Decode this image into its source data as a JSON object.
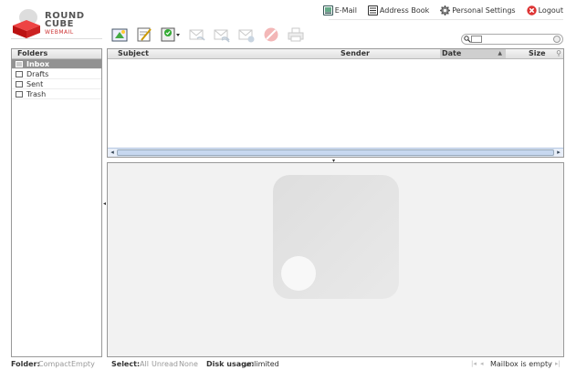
{
  "logo": {
    "line1": "ROUND",
    "line2": "CUBE",
    "line3": "WEBMAIL"
  },
  "topnav": {
    "items": [
      {
        "label": "E-Mail",
        "icon": "mail-icon"
      },
      {
        "label": "Address Book",
        "icon": "address-book-icon"
      },
      {
        "label": "Personal Settings",
        "icon": "gear-icon"
      },
      {
        "label": "Logout",
        "icon": "logout-icon"
      }
    ]
  },
  "toolbar": {
    "buttons": [
      {
        "name": "check-mail",
        "icon": "check-mail-icon",
        "enabled": true
      },
      {
        "name": "compose",
        "icon": "compose-icon",
        "enabled": true
      },
      {
        "name": "mark",
        "icon": "mark-icon",
        "enabled": true
      },
      {
        "name": "reply",
        "icon": "reply-icon",
        "enabled": false
      },
      {
        "name": "reply-all",
        "icon": "reply-all-icon",
        "enabled": false
      },
      {
        "name": "forward",
        "icon": "forward-icon",
        "enabled": false
      },
      {
        "name": "delete",
        "icon": "delete-icon",
        "enabled": false
      },
      {
        "name": "print",
        "icon": "print-icon",
        "enabled": false
      }
    ]
  },
  "folders": {
    "title": "Folders",
    "items": [
      {
        "label": "Inbox",
        "selected": true
      },
      {
        "label": "Drafts",
        "selected": false
      },
      {
        "label": "Sent",
        "selected": false
      },
      {
        "label": "Trash",
        "selected": false
      }
    ]
  },
  "messagelist": {
    "columns": {
      "subject": "Subject",
      "sender": "Sender",
      "date": "Date",
      "size": "Size"
    },
    "sort_indicator": "▲"
  },
  "footer": {
    "folder_label": "Folder:",
    "compact": "Compact",
    "empty": "Empty",
    "select_label": "Select:",
    "all": "All",
    "unread": "Unread",
    "none": "None",
    "disk_label": "Disk usage:",
    "disk_value": "unlimited",
    "status": "Mailbox is empty"
  },
  "colors": {
    "brand_red": "#cc2222",
    "selected_folder": "#929292",
    "scrollbar": "#dce6f4"
  }
}
